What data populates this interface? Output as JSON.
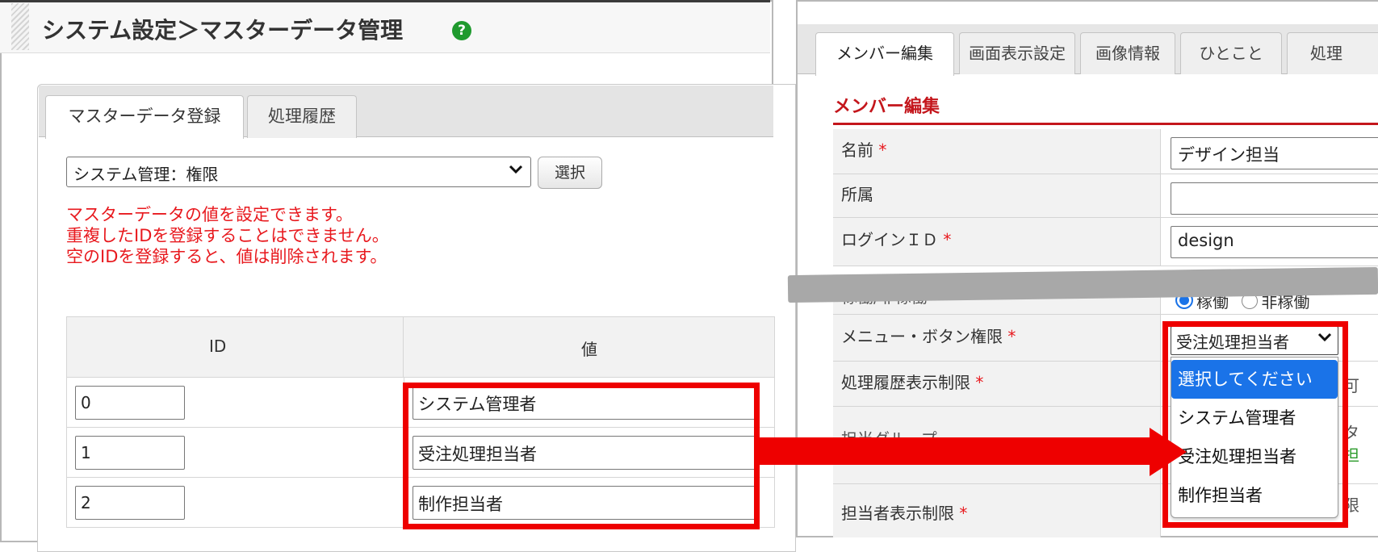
{
  "left": {
    "title": "システム設定＞マスターデータ管理",
    "help_icon_glyph": "?",
    "tabs": [
      {
        "label": "マスターデータ登録",
        "active": true
      },
      {
        "label": "処理履歴",
        "active": false
      }
    ],
    "master_select_value": "システム管理：権限",
    "select_button_label": "選択",
    "info_lines": [
      "マスターデータの値を設定できます。",
      "重複したIDを登録することはできません。",
      "空のIDを登録すると、値は削除されます。"
    ],
    "table": {
      "headers": [
        "ID",
        "値"
      ],
      "rows": [
        {
          "id": "0",
          "value": "システム管理者"
        },
        {
          "id": "1",
          "value": "受注処理担当者"
        },
        {
          "id": "2",
          "value": "制作担当者"
        }
      ]
    }
  },
  "right": {
    "tabs": [
      {
        "label": "メンバー編集",
        "active": true
      },
      {
        "label": "画面表示設定",
        "active": false
      },
      {
        "label": "画像情報",
        "active": false
      },
      {
        "label": "ひとこと",
        "active": false
      },
      {
        "label": "処理",
        "active": false
      }
    ],
    "section_title": "メンバー編集",
    "required_mark": "*",
    "fields": {
      "name": {
        "label": "名前",
        "value": "デザイン担当"
      },
      "affiliation": {
        "label": "所属",
        "value": ""
      },
      "login_id": {
        "label": "ログインＩＤ",
        "value": "design"
      },
      "status": {
        "label": "稼働/非稼働",
        "options": [
          "稼働",
          "非稼働"
        ],
        "selected": "稼働"
      },
      "menu_permission": {
        "label": "メニュー・ボタン権限",
        "value": "受注処理担当者",
        "options": [
          "選択してください",
          "システム管理者",
          "受注処理担当者",
          "制作担当者"
        ],
        "highlighted_option": "選択してください"
      },
      "history_limit": {
        "label": "処理履歴表示制限"
      },
      "group": {
        "label": "担当グループ"
      },
      "person_limit": {
        "label": "担当者表示制限"
      }
    },
    "peek_text": [
      "可",
      "タ",
      "担",
      "限"
    ]
  },
  "colors": {
    "highlight_red": "#ee0000",
    "required_red": "#e8191e",
    "section_red": "#c4161c",
    "selected_blue": "#1a73e8",
    "help_green": "#1f9a2e"
  },
  "icons": {
    "chevron": "chevron-down-icon",
    "help": "help-circle-icon",
    "arrow": "right-arrow-icon"
  }
}
